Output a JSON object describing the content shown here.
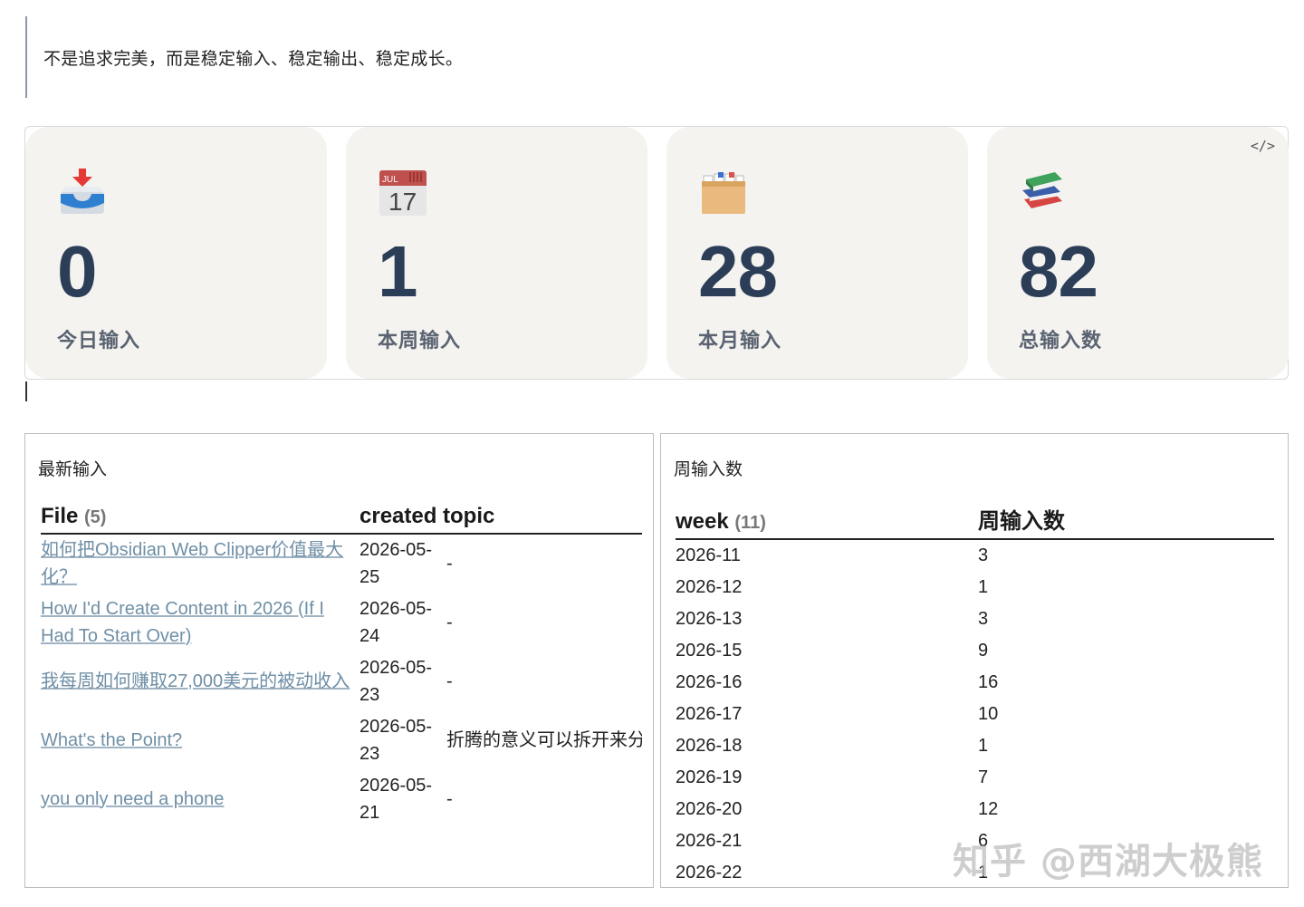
{
  "quote": {
    "text": "不是追求完美，而是稳定输入、稳定输出、稳定成长。"
  },
  "stats": {
    "code_toggle": "</>",
    "cards": [
      {
        "icon": "inbox-tray-icon",
        "value": "0",
        "label": "今日输入"
      },
      {
        "icon": "calendar-icon",
        "calendar_month": "JUL",
        "calendar_day": "17",
        "value": "1",
        "label": "本周输入"
      },
      {
        "icon": "card-file-box-icon",
        "value": "28",
        "label": "本月输入"
      },
      {
        "icon": "books-icon",
        "value": "82",
        "label": "总输入数"
      }
    ]
  },
  "recent": {
    "title": "最新输入",
    "columns": {
      "file": "File",
      "file_count": "(5)",
      "created": "created",
      "topic": "topic"
    },
    "rows": [
      {
        "file": "如何把Obsidian Web Clipper价值最大化？",
        "created": "2026-05-25",
        "topic": "-"
      },
      {
        "file": "How I'd Create Content in 2026 (If I Had To Start Over)",
        "created": "2026-05-24",
        "topic": "-"
      },
      {
        "file": "我每周如何赚取27,000美元的被动收入",
        "created": "2026-05-23",
        "topic": "-"
      },
      {
        "file": "What's the Point?",
        "created": "2026-05-23",
        "topic": "折腾的意义可以拆开来分"
      },
      {
        "file": "you only need a phone",
        "created": "2026-05-21",
        "topic": "-"
      }
    ]
  },
  "weekly": {
    "title": "周输入数",
    "columns": {
      "week": "week",
      "week_count": "(11)",
      "count": "周输入数"
    },
    "rows": [
      {
        "week": "2026-11",
        "count": "3"
      },
      {
        "week": "2026-12",
        "count": "1"
      },
      {
        "week": "2026-13",
        "count": "3"
      },
      {
        "week": "2026-15",
        "count": "9"
      },
      {
        "week": "2026-16",
        "count": "16"
      },
      {
        "week": "2026-17",
        "count": "10"
      },
      {
        "week": "2026-18",
        "count": "1"
      },
      {
        "week": "2026-19",
        "count": "7"
      },
      {
        "week": "2026-20",
        "count": "12"
      },
      {
        "week": "2026-21",
        "count": "6"
      },
      {
        "week": "2026-22",
        "count": "1"
      }
    ]
  },
  "watermark": "知乎 @西湖大极熊"
}
